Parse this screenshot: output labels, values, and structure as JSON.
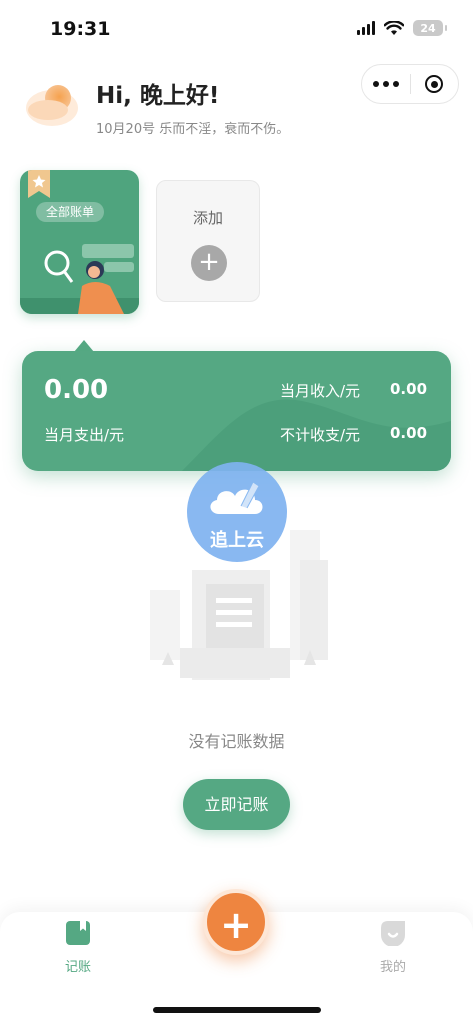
{
  "status": {
    "time": "19:31",
    "battery": "24"
  },
  "header": {
    "greeting": "Hi, 晚上好!",
    "date": "10月20号",
    "quote": "乐而不淫，衰而不伤。"
  },
  "books": {
    "current_label": "全部账单",
    "add_label": "添加"
  },
  "summary": {
    "balance": "0.00",
    "income_label": "当月收入/元",
    "income_value": "0.00",
    "expense_label": "当月支出/元",
    "excluded_label": "不计收支/元",
    "excluded_value": "0.00"
  },
  "watermark": {
    "text": "追上云"
  },
  "empty": {
    "message": "没有记账数据",
    "action_label": "立即记账"
  },
  "tabbar": {
    "tabs": [
      {
        "label": "记账",
        "active": true
      },
      {
        "label": "我的",
        "active": false
      }
    ]
  },
  "colors": {
    "accent": "#55a883",
    "fab": "#ee8540"
  },
  "icons": [
    "signal-icon",
    "wifi-icon",
    "battery-icon",
    "more-icon",
    "target-icon",
    "moon-icon",
    "plus-icon",
    "book-icon",
    "profile-icon"
  ]
}
